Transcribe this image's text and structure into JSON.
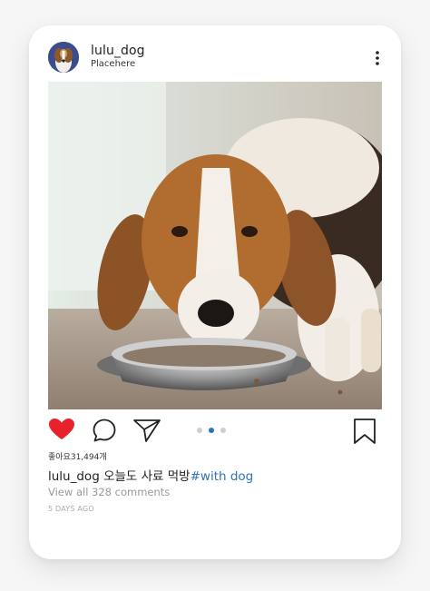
{
  "post": {
    "username": "lulu_dog",
    "location": "Placehere",
    "image_alt": "Beagle eating from a metal bowl",
    "likes_text": "좋아요31,494개",
    "caption": {
      "username": "lulu_dog",
      "text": "오늘도 사료 먹방",
      "hashtag": "#with dog"
    },
    "view_comments": "View all 328 comments",
    "timestamp": "5 DAYS AGO"
  },
  "icons": {
    "more": "more-vertical-icon",
    "like": "heart-icon",
    "comment": "comment-icon",
    "share": "send-icon",
    "save": "bookmark-icon"
  },
  "carousel": {
    "total": 3,
    "active_index": 1
  },
  "colors": {
    "like": "#e8222a",
    "hashtag": "#2f73b8",
    "active_dot": "#2f73b8",
    "inactive_dot": "#cfcfcf"
  }
}
